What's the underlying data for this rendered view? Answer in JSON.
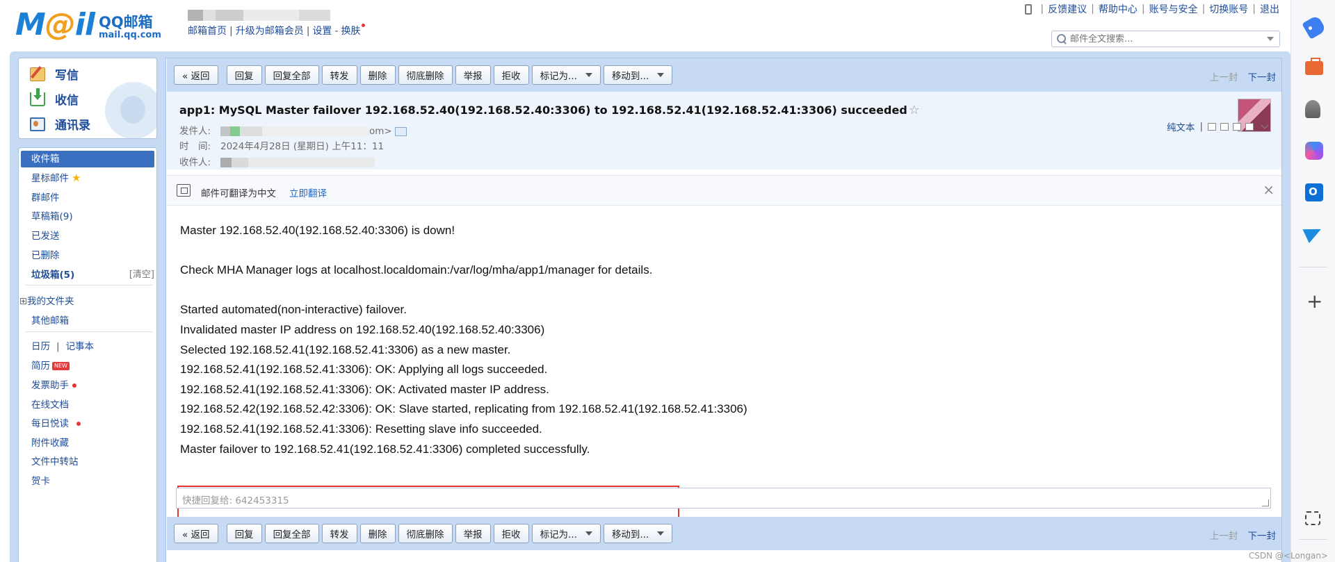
{
  "header": {
    "logo_text": "Mail",
    "logo_brand": "QQ邮箱",
    "logo_domain": "mail.qq.com",
    "top_links": [
      "邮箱首页",
      "升级为邮箱会员",
      "设置",
      "换肤"
    ],
    "right_links": [
      "反馈建议",
      "帮助中心",
      "账号与安全",
      "切换账号",
      "退出"
    ],
    "search_placeholder": "邮件全文搜索..."
  },
  "sidebar": {
    "quick_actions": [
      "写信",
      "收信",
      "通讯录"
    ],
    "folders": {
      "inbox": "收件箱",
      "starred": "星标邮件",
      "group": "群邮件",
      "drafts": "草稿箱(9)",
      "sent": "已发送",
      "deleted": "已删除",
      "spam": "垃圾箱(5)",
      "spam_clear": "[清空]",
      "my_folders": "我的文件夹",
      "other_mail": "其他邮箱",
      "calendar": "日历",
      "notes": "记事本",
      "resume": "简历",
      "resume_badge": "NEW",
      "invoice": "发票助手",
      "docs": "在线文档",
      "daily": "每日悦读",
      "attachments": "附件收藏",
      "transfer": "文件中转站",
      "cards": "贺卡"
    }
  },
  "toolbar": {
    "back": "« 返回",
    "reply": "回复",
    "reply_all": "回复全部",
    "forward": "转发",
    "delete": "删除",
    "delete_perm": "彻底删除",
    "report": "举报",
    "reject": "拒收",
    "mark_as": "标记为...",
    "move_to": "移动到...",
    "prev": "上一封",
    "next": "下一封"
  },
  "message": {
    "subject": "app1: MySQL Master failover 192.168.52.40(192.168.52.40:3306) to 192.168.52.41(192.168.52.41:3306) succeeded",
    "from_label": "发件人:",
    "from_tail": "om>",
    "time_label": "时　间:",
    "time_value": "2024年4月28日 (星期日) 上午11：11",
    "to_label": "收件人:",
    "plain_text": "纯文本",
    "body_lines": [
      "Master 192.168.52.40(192.168.52.40:3306) is down!",
      "",
      "Check MHA Manager logs at localhost.localdomain:/var/log/mha/app1/manager for details.",
      "",
      "Started automated(non-interactive) failover.",
      "Invalidated master IP address on 192.168.52.40(192.168.52.40:3306)",
      "Selected 192.168.52.41(192.168.52.41:3306) as a new master.",
      "192.168.52.41(192.168.52.41:3306): OK: Applying all logs succeeded.",
      "192.168.52.41(192.168.52.41:3306): OK: Activated master IP address.",
      "192.168.52.42(192.168.52.42:3306): OK: Slave started, replicating from 192.168.52.41(192.168.52.41:3306)",
      "192.168.52.41(192.168.52.41:3306): Resetting slave info succeeded.",
      "Master failover to 192.168.52.41(192.168.52.41:3306) completed successfully."
    ]
  },
  "translate": {
    "text": "邮件可翻译为中文",
    "link": "立即翻译"
  },
  "quick_reply": {
    "placeholder": "快捷回复给: 642453315"
  },
  "watermark": "CSDN @<Longan>",
  "colors": {
    "frame": "#c6dbf3",
    "link": "#1f4d9a",
    "active_folder": "#3a6fc0",
    "highlight_box": "#e33434"
  }
}
